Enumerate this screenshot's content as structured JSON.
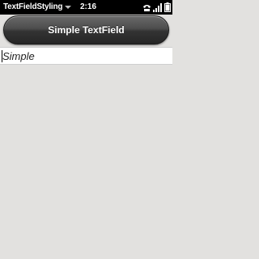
{
  "status_bar": {
    "app_name": "TextFieldStyling",
    "time": "2:16",
    "icons": [
      "phone-icon",
      "signal-icon",
      "battery-icon"
    ]
  },
  "header": {
    "title": "Simple TextField"
  },
  "textfield": {
    "value": "Simple",
    "placeholder": ""
  },
  "colors": {
    "background": "#e2e1df",
    "header": "#3a3a3a",
    "status_bar": "#000000"
  }
}
